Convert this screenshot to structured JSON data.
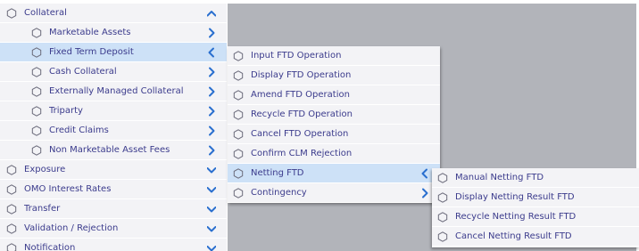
{
  "colors": {
    "accent": "#2a6fcf",
    "text": "#3b3b8c",
    "selected": "#cde1f7",
    "menu_bg": "#f3f3f6",
    "backdrop": "#b2b4ba"
  },
  "main_menu": {
    "items": [
      {
        "label": "Collateral",
        "chevron": "chevron-up-icon"
      },
      {
        "label": "Marketable Assets",
        "chevron": "chevron-right-icon"
      },
      {
        "label": "Fixed Term Deposit",
        "chevron": "chevron-left-icon"
      },
      {
        "label": "Cash Collateral",
        "chevron": "chevron-right-icon"
      },
      {
        "label": "Externally Managed Collateral",
        "chevron": "chevron-right-icon"
      },
      {
        "label": "Triparty",
        "chevron": "chevron-right-icon"
      },
      {
        "label": "Credit Claims",
        "chevron": "chevron-right-icon"
      },
      {
        "label": "Non Marketable Asset Fees",
        "chevron": "chevron-right-icon"
      },
      {
        "label": "Exposure",
        "chevron": "chevron-down-icon"
      },
      {
        "label": "OMO Interest Rates",
        "chevron": "chevron-down-icon"
      },
      {
        "label": "Transfer",
        "chevron": "chevron-down-icon"
      },
      {
        "label": "Validation / Rejection",
        "chevron": "chevron-down-icon"
      },
      {
        "label": "Notification",
        "chevron": "chevron-down-icon"
      }
    ]
  },
  "ftd_menu": {
    "items": [
      {
        "label": "Input FTD Operation"
      },
      {
        "label": "Display FTD Operation"
      },
      {
        "label": "Amend FTD Operation"
      },
      {
        "label": "Recycle FTD Operation"
      },
      {
        "label": "Cancel FTD Operation"
      },
      {
        "label": "Confirm CLM Rejection"
      },
      {
        "label": "Netting FTD",
        "chevron": "chevron-left-icon"
      },
      {
        "label": "Contingency",
        "chevron": "chevron-right-icon"
      }
    ]
  },
  "netting_menu": {
    "items": [
      {
        "label": "Manual Netting FTD"
      },
      {
        "label": "Display Netting Result FTD"
      },
      {
        "label": "Recycle Netting Result FTD"
      },
      {
        "label": "Cancel Netting Result FTD"
      }
    ]
  }
}
